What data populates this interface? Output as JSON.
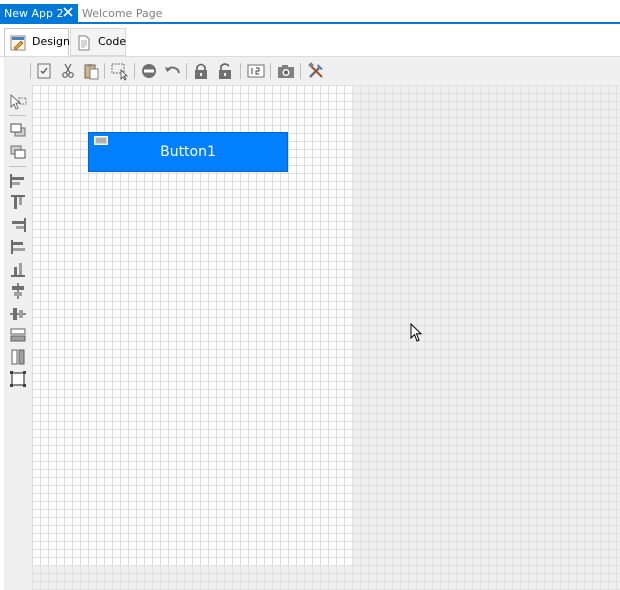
{
  "doc_tabs": {
    "active": "New App 2",
    "inactive": "Welcome Page"
  },
  "mode_tabs": {
    "design": "Design",
    "code": "Code"
  },
  "toolbar_icons": [
    "properties-icon",
    "cut-icon",
    "paste-icon",
    "select-icon",
    "stop-icon",
    "undo-icon",
    "lock-icon",
    "unlock-icon",
    "tab-order-icon",
    "screenshot-icon",
    "tools-icon"
  ],
  "left_toolbar_icons": [
    "pointer-icon",
    "bring-front-icon",
    "send-back-icon",
    "align-left-icon",
    "align-top-icon",
    "align-right-icon",
    "align-middle-vertical-icon",
    "align-bottom-icon",
    "center-horizontal-icon",
    "center-vertical-icon",
    "same-height-icon",
    "same-width-icon",
    "same-size-icon"
  ],
  "canvas": {
    "button_label": "Button1"
  },
  "colors": {
    "accent": "#0078d7",
    "button": "#0080ff"
  }
}
